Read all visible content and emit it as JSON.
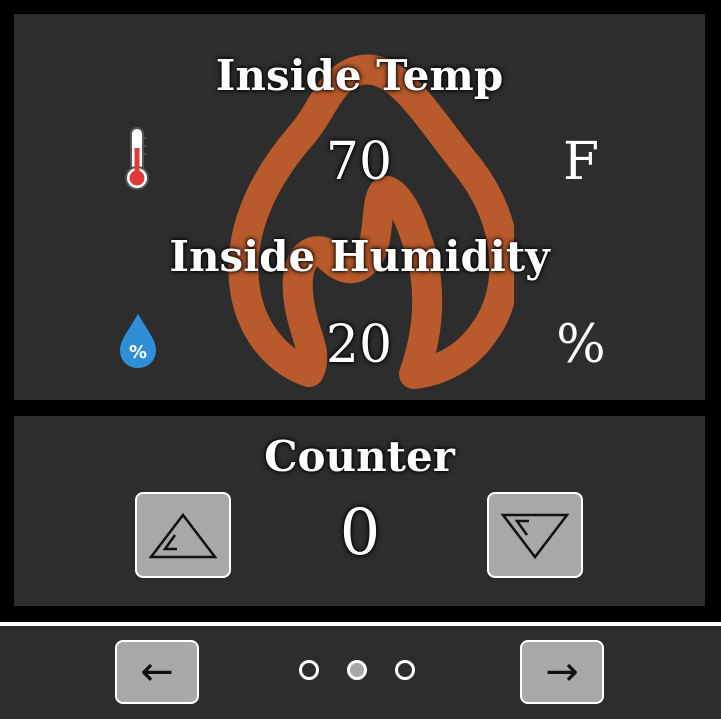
{
  "sensors": {
    "temp": {
      "label": "Inside Temp",
      "value": "70",
      "unit": "F",
      "icon": "thermometer-icon"
    },
    "humidity": {
      "label": "Inside Humidity",
      "value": "20",
      "unit": "%",
      "icon": "humidity-drop-icon",
      "icon_text": "%"
    },
    "background_icon": "flame-icon"
  },
  "counter": {
    "label": "Counter",
    "value": "0",
    "increment_icon": "triangle-up-icon",
    "decrement_icon": "triangle-down-icon"
  },
  "nav": {
    "prev_label": "←",
    "next_label": "→",
    "pages": 3,
    "active_page": 2
  },
  "colors": {
    "panel": "#2d2d2d",
    "flame": "#b85a2b",
    "button": "#a8a8a8",
    "thermometer": "#e03b3b",
    "drop": "#2f8fd6"
  }
}
